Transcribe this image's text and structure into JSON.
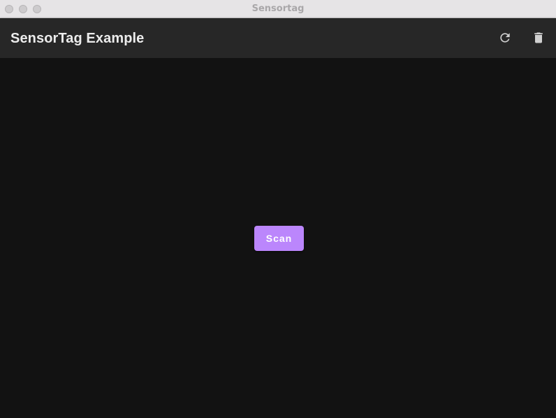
{
  "window": {
    "title": "Sensortag",
    "controls": [
      "close",
      "minimize",
      "zoom"
    ]
  },
  "appbar": {
    "title": "SensorTag Example",
    "actions": [
      {
        "icon": "refresh-icon",
        "label": "Refresh"
      },
      {
        "icon": "delete-icon",
        "label": "Delete"
      }
    ],
    "background": "#272727"
  },
  "main": {
    "scan_label": "Scan",
    "background": "#121212"
  },
  "colors": {
    "accent": "#bb86fc",
    "icon": "#d0d0d0"
  }
}
